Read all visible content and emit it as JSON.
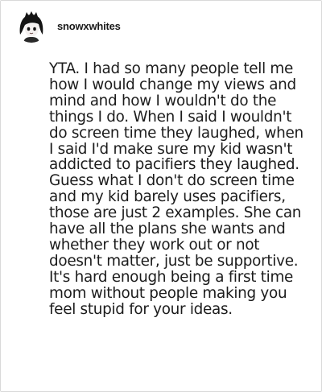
{
  "post": {
    "username": "snowxwhites",
    "avatar_icon": "avatar-icon",
    "body": "YTA. I had so many people tell me how I would change my views and mind and how I wouldn't do the things I do. When I said I wouldn't do screen time they laughed, when I said I'd make sure my kid wasn't addicted to pacifiers they laughed. Guess what I don't do screen time and my kid barely uses pacifiers, those are just 2 examples. She can have all the plans she wants and whether they work out or not doesn't matter, just be supportive. It's hard enough being a first time mom without people making you feel stupid for your ideas."
  },
  "colors": {
    "text": "#1c1c1c",
    "border": "#d9d9d9",
    "background": "#ffffff"
  }
}
